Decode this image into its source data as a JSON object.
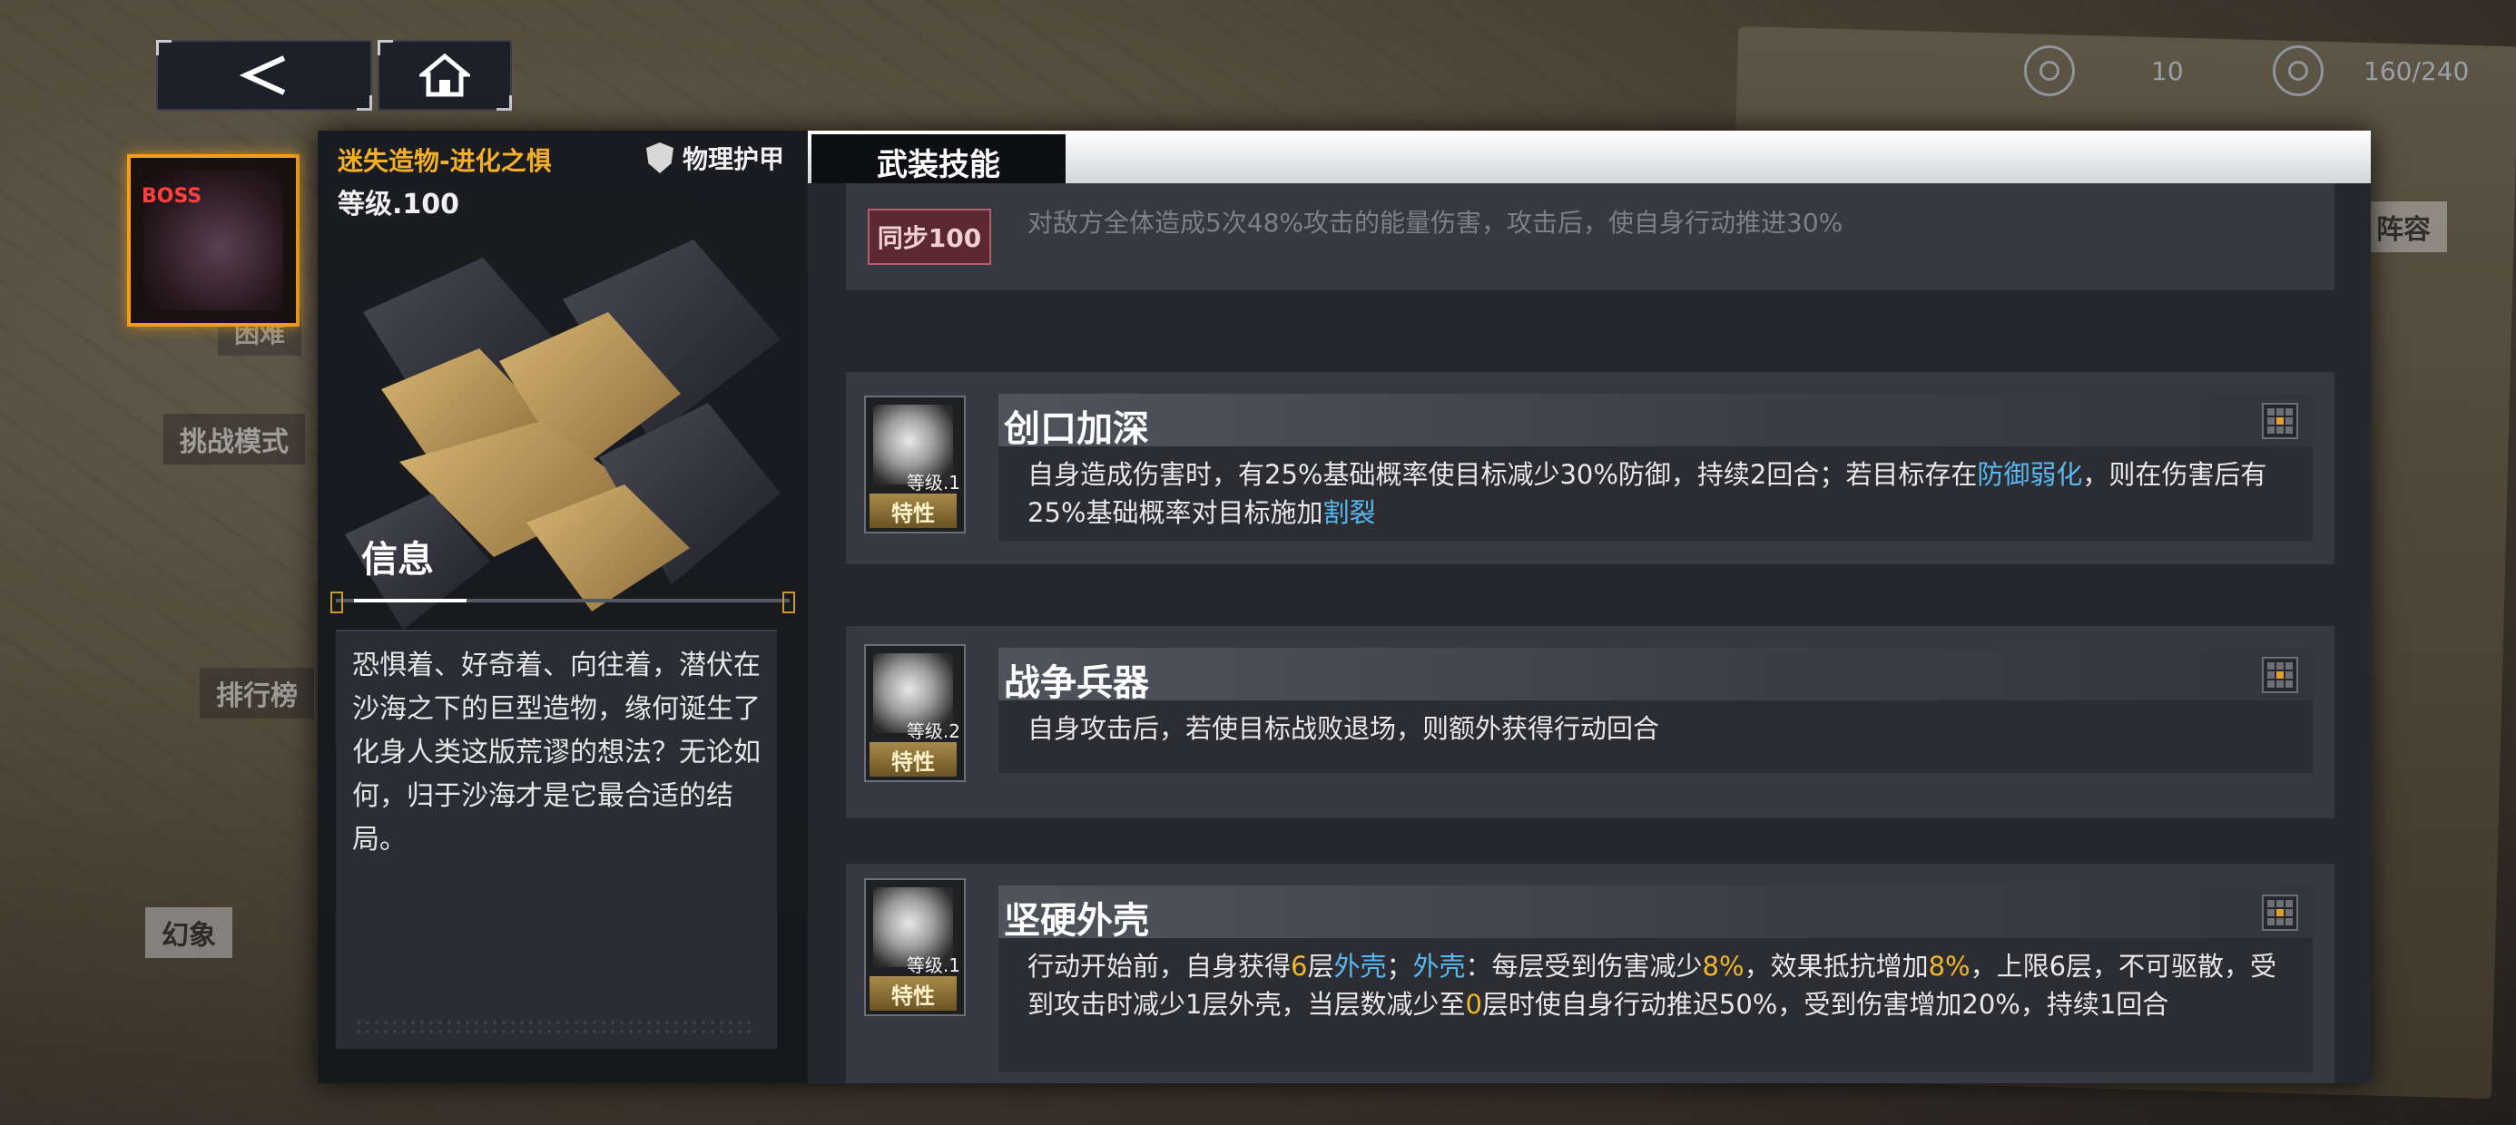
{
  "top_nav": {
    "back_icon": "back-chevron-icon",
    "home_icon": "home-icon"
  },
  "resources": {
    "stamina_value": "10",
    "points_value": "160/240"
  },
  "map_labels": {
    "challenge": "挑战模式",
    "ranking": "排行榜",
    "illusion": "幻象",
    "lineup": "阵容",
    "difficulty": "困难"
  },
  "boss": {
    "avatar_tag": "BOSS",
    "name": "迷失造物-进化之惧",
    "level": "等级.100",
    "armor_type": "物理护甲",
    "info_title": "信息",
    "info_text": "恐惧着、好奇着、向往着，潜伏在沙海之下的巨型造物，缘何诞生了化身人类这版荒谬的想法？无论如何，归于沙海才是它最合适的结局。"
  },
  "tabs": {
    "active": "武装技能"
  },
  "skills": [
    {
      "sync_label": "同步100",
      "faded_desc": "对敌方全体造成5次48%攻击的能量伤害，攻击后，使自身行动推进30%"
    },
    {
      "name": "创口加深",
      "level": "等级.1",
      "tag": "特性",
      "desc_parts": [
        "自身造成伤害时，有25%基础概率使目标减少30%防御，持续2回合；若目标存在",
        "防御弱化",
        "，则在伤害后有25%基础概率对目标施加",
        "割裂"
      ]
    },
    {
      "name": "战争兵器",
      "level": "等级.2",
      "tag": "特性",
      "desc": "自身攻击后，若使目标战败退场，则额外获得行动回合"
    },
    {
      "name": "坚硬外壳",
      "level": "等级.1",
      "tag": "特性",
      "desc_parts": [
        "行动开始前，自身获得",
        "6",
        "层",
        "外壳",
        "；",
        "外壳",
        "：每层受到伤害减少",
        "8%",
        "，效果抵抗增加",
        "8%",
        "，上限6层，不可驱散，受到攻击时减少1层外壳，当层数减少至",
        "0",
        "层时使自身行动推迟50%，受到伤害增加20%，持续1回合"
      ]
    }
  ],
  "colors": {
    "accent_gold": "#f2b02a",
    "highlight_blue": "#58b8f0",
    "panel": "#14161b"
  }
}
